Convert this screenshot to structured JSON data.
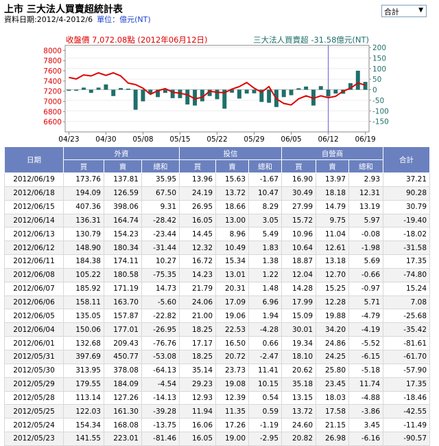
{
  "header": {
    "title": "上市 三大法人買賣超統計表",
    "date_range": "資料日期:2012/4-2012/6",
    "unit": "單位：億元(NT)"
  },
  "select": {
    "value": "合計",
    "arrow": "▼"
  },
  "chart_header": {
    "left": "收盤價 7,072.08點 (2012年06月12日)",
    "right": "三大法人買賣超 -31.58億元(NT)"
  },
  "chart_data": {
    "type": "bar",
    "x": [
      "04/23",
      "04/24",
      "04/25",
      "04/26",
      "04/27",
      "04/30",
      "05/02",
      "05/03",
      "05/04",
      "05/07",
      "05/08",
      "05/09",
      "05/10",
      "05/11",
      "05/14",
      "05/15",
      "05/16",
      "05/17",
      "05/18",
      "05/21",
      "05/22",
      "05/23",
      "05/24",
      "05/25",
      "05/28",
      "05/29",
      "05/30",
      "05/31",
      "06/01",
      "06/04",
      "06/05",
      "06/06",
      "06/07",
      "06/08",
      "06/11",
      "06/12",
      "06/13",
      "06/14",
      "06/15",
      "06/18",
      "06/19"
    ],
    "xticks": [
      "04/23",
      "04/30",
      "05/08",
      "05/15",
      "05/22",
      "05/29",
      "06/05",
      "06/12",
      "06/19"
    ],
    "highlight": "06/12",
    "series": [
      {
        "axis": "right",
        "type": "bar",
        "color": "#1f6f6a",
        "values": [
          -5,
          -5,
          10,
          -15,
          10,
          25,
          -30,
          8,
          5,
          -95,
          -55,
          -20,
          -35,
          -15,
          -40,
          -40,
          -70,
          -75,
          -55,
          -30,
          -45,
          -90,
          -14,
          -42,
          -18,
          -17,
          -58,
          -62,
          -82,
          -35,
          -26,
          7,
          15,
          -75,
          17,
          -32,
          -18,
          -19,
          31,
          90,
          37
        ]
      },
      {
        "axis": "left",
        "type": "line",
        "color": "#e00000",
        "values": [
          7470,
          7440,
          7520,
          7500,
          7560,
          7510,
          7560,
          7500,
          7360,
          7330,
          7260,
          7140,
          7210,
          7250,
          7180,
          7160,
          7130,
          7050,
          7080,
          7200,
          7180,
          7170,
          7240,
          7290,
          7370,
          7260,
          7180,
          7290,
          7050,
          6960,
          6930,
          7050,
          7110,
          7060,
          7110,
          7072,
          7100,
          7200,
          7260,
          7360,
          7320
        ]
      }
    ],
    "y_left": {
      "range": [
        6400,
        8100
      ],
      "ticks": [
        6600,
        6800,
        7000,
        7200,
        7400,
        7600,
        7800,
        8000
      ],
      "color": "#e00000"
    },
    "y_right": {
      "range": [
        -200,
        210
      ],
      "ticks": [
        -150,
        -100,
        -50,
        0,
        50,
        100,
        150,
        200
      ],
      "color": "#1f6f6a"
    }
  },
  "table": {
    "groups": [
      "日期",
      "外資",
      "投信",
      "自營商",
      "合計"
    ],
    "subheaders": [
      "買",
      "賣",
      "總和",
      "買",
      "賣",
      "總和",
      "買",
      "賣",
      "總和"
    ],
    "rows": [
      [
        "2012/06/19",
        "173.76",
        "137.81",
        "35.95",
        "13.96",
        "15.63",
        "-1.67",
        "16.90",
        "13.97",
        "2.93",
        "37.21"
      ],
      [
        "2012/06/18",
        "194.09",
        "126.59",
        "67.50",
        "24.19",
        "13.72",
        "10.47",
        "30.49",
        "18.18",
        "12.31",
        "90.28"
      ],
      [
        "2012/06/15",
        "407.36",
        "398.06",
        "9.31",
        "26.95",
        "18.66",
        "8.29",
        "27.99",
        "14.79",
        "13.19",
        "30.79"
      ],
      [
        "2012/06/14",
        "136.31",
        "164.74",
        "-28.42",
        "16.05",
        "13.00",
        "3.05",
        "15.72",
        "9.75",
        "5.97",
        "-19.40"
      ],
      [
        "2012/06/13",
        "130.79",
        "154.23",
        "-23.44",
        "14.45",
        "8.96",
        "5.49",
        "10.96",
        "11.04",
        "-0.08",
        "-18.02"
      ],
      [
        "2012/06/12",
        "148.90",
        "180.34",
        "-31.44",
        "12.32",
        "10.49",
        "1.83",
        "10.64",
        "12.61",
        "-1.98",
        "-31.58"
      ],
      [
        "2012/06/11",
        "184.38",
        "174.11",
        "10.27",
        "16.72",
        "15.34",
        "1.38",
        "18.87",
        "13.18",
        "5.69",
        "17.35"
      ],
      [
        "2012/06/08",
        "105.22",
        "180.58",
        "-75.35",
        "14.23",
        "13.01",
        "1.22",
        "12.04",
        "12.70",
        "-0.66",
        "-74.80"
      ],
      [
        "2012/06/07",
        "185.92",
        "171.19",
        "14.73",
        "21.79",
        "20.31",
        "1.48",
        "14.28",
        "15.25",
        "-0.97",
        "15.24"
      ],
      [
        "2012/06/06",
        "158.11",
        "163.70",
        "-5.60",
        "24.06",
        "17.09",
        "6.96",
        "17.99",
        "12.28",
        "5.71",
        "7.08"
      ],
      [
        "2012/06/05",
        "135.05",
        "157.87",
        "-22.82",
        "21.00",
        "19.06",
        "1.94",
        "15.09",
        "19.88",
        "-4.79",
        "-25.68"
      ],
      [
        "2012/06/04",
        "150.06",
        "177.01",
        "-26.95",
        "18.25",
        "22.53",
        "-4.28",
        "30.01",
        "34.20",
        "-4.19",
        "-35.42"
      ],
      [
        "2012/06/01",
        "132.68",
        "209.43",
        "-76.76",
        "17.17",
        "16.50",
        "0.66",
        "19.34",
        "24.86",
        "-5.52",
        "-81.61"
      ],
      [
        "2012/05/31",
        "397.69",
        "450.77",
        "-53.08",
        "18.25",
        "20.72",
        "-2.47",
        "18.10",
        "24.25",
        "-6.15",
        "-61.70"
      ],
      [
        "2012/05/30",
        "313.95",
        "378.08",
        "-64.13",
        "35.14",
        "23.73",
        "11.41",
        "20.62",
        "25.80",
        "-5.18",
        "-57.90"
      ],
      [
        "2012/05/29",
        "179.55",
        "184.09",
        "-4.54",
        "29.23",
        "19.08",
        "10.15",
        "35.18",
        "23.45",
        "11.74",
        "17.35"
      ],
      [
        "2012/05/28",
        "113.14",
        "127.26",
        "-14.13",
        "12.93",
        "12.39",
        "0.54",
        "13.15",
        "18.03",
        "-4.88",
        "-18.46"
      ],
      [
        "2012/05/25",
        "122.03",
        "161.30",
        "-39.28",
        "11.94",
        "11.35",
        "0.59",
        "13.72",
        "17.58",
        "-3.86",
        "-42.55"
      ],
      [
        "2012/05/24",
        "154.34",
        "168.08",
        "-13.75",
        "16.06",
        "17.26",
        "-1.19",
        "24.60",
        "21.15",
        "3.45",
        "-11.49"
      ],
      [
        "2012/05/23",
        "141.55",
        "223.01",
        "-81.46",
        "16.05",
        "19.00",
        "-2.95",
        "20.82",
        "26.98",
        "-6.16",
        "-90.57"
      ]
    ]
  }
}
